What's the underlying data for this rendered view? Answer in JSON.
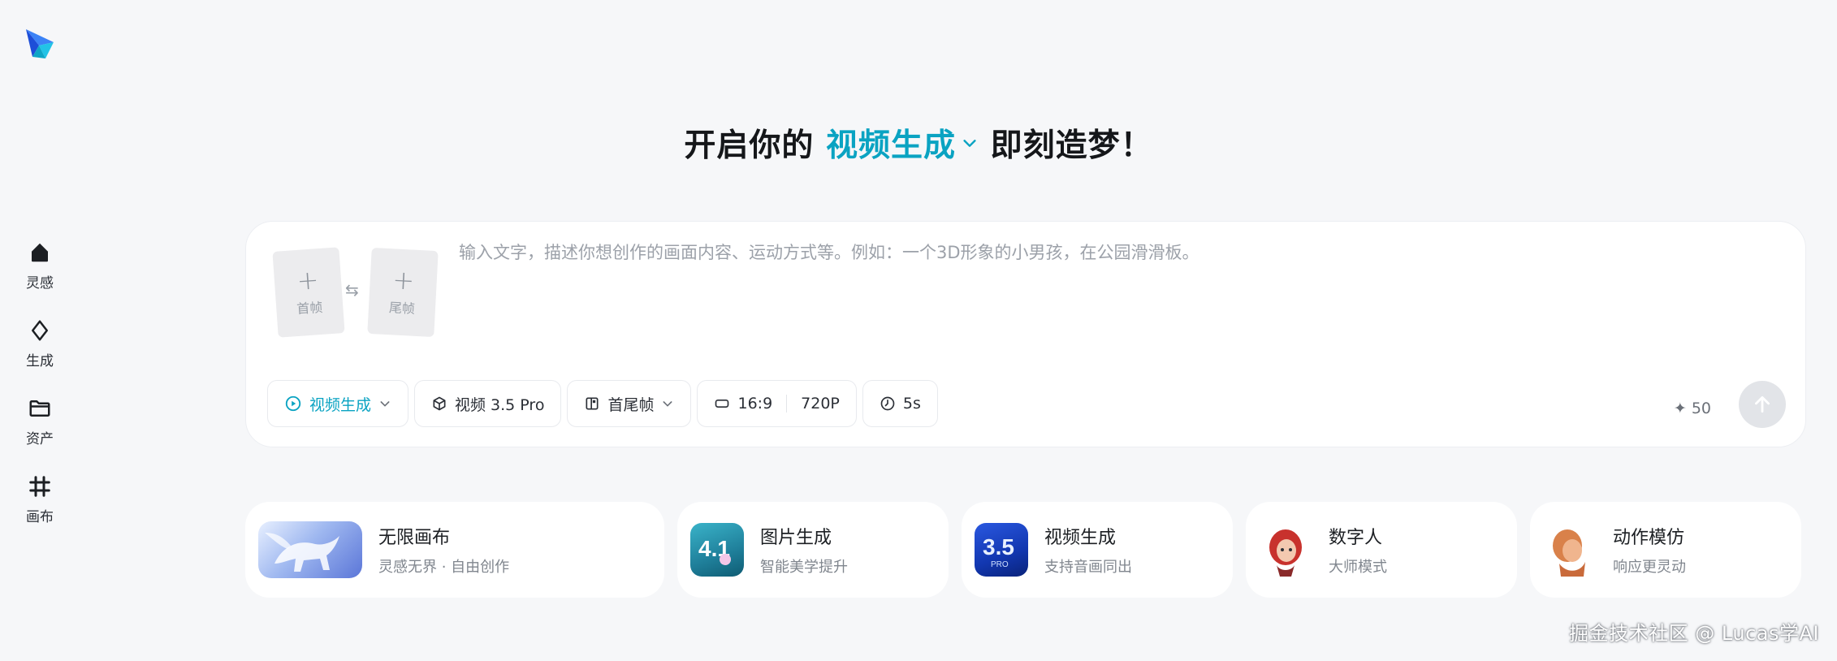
{
  "sidebar": {
    "items": [
      {
        "label": "灵感",
        "icon": "home-icon"
      },
      {
        "label": "生成",
        "icon": "sparkle-diamond-icon"
      },
      {
        "label": "资产",
        "icon": "folder-icon"
      },
      {
        "label": "画布",
        "icon": "crop-grid-icon"
      }
    ]
  },
  "headline": {
    "prefix": "开启你的",
    "mode": "视频生成",
    "suffix": "即刻造梦！"
  },
  "composer": {
    "first_frame_label": "首帧",
    "last_frame_label": "尾帧",
    "prompt_placeholder": "输入文字，描述你想创作的画面内容、运动方式等。例如：一个3D形象的小男孩，在公园滑滑板。",
    "prompt_value": "",
    "toolbar": {
      "mode_label": "视频生成",
      "model_label": "视频 3.5 Pro",
      "frame_label": "首尾帧",
      "ratio_label": "16:9",
      "resolution_label": "720P",
      "duration_label": "5s"
    },
    "credits": "50",
    "accent_color": "#0aa3c2"
  },
  "cards": [
    {
      "title": "无限画布",
      "subtitle": "灵感无界 · 自由创作",
      "thumb_text": ""
    },
    {
      "title": "图片生成",
      "subtitle": "智能美学提升",
      "thumb_text": "4.1"
    },
    {
      "title": "视频生成",
      "subtitle": "支持音画同出",
      "thumb_text": "3.5",
      "thumb_badge": "PRO"
    },
    {
      "title": "数字人",
      "subtitle": "大师模式",
      "thumb_text": ""
    },
    {
      "title": "动作模仿",
      "subtitle": "响应更灵动",
      "thumb_text": ""
    }
  ],
  "watermark": "掘金技术社区 @ Lucas学AI"
}
